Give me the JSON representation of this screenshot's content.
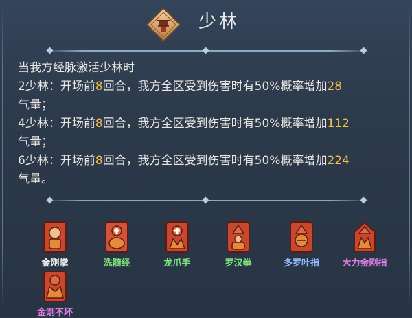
{
  "header": {
    "title": "少林",
    "emblem_icon": "temple-emblem-icon"
  },
  "description": {
    "intro": "当我方经脉激活少林时",
    "tiers": [
      {
        "label": "2少林：开场前",
        "rounds": "8",
        "middle": "回合，我方全区受到伤害时有",
        "chance": "50%",
        "tail": "概率增加",
        "amount": "28",
        "suffix": "气量；"
      },
      {
        "label": "4少林：开场前",
        "rounds": "8",
        "middle": "回合，我方全区受到伤害时有",
        "chance": "50%",
        "tail": "概率增加",
        "amount": "112",
        "suffix": "气量；"
      },
      {
        "label": "6少林：开场前",
        "rounds": "8",
        "middle": "回合，我方全区受到伤害时有",
        "chance": "50%",
        "tail": "概率增加",
        "amount": "224",
        "suffix": "气量。"
      }
    ]
  },
  "skills": [
    {
      "name": "金刚掌",
      "color": "#f2f2f2",
      "icon": "fist-strike-icon"
    },
    {
      "name": "洗髓经",
      "color": "#7ee07a",
      "icon": "meditation-cross-icon"
    },
    {
      "name": "龙爪手",
      "color": "#7ee07a",
      "icon": "dragon-claw-icon"
    },
    {
      "name": "罗汉拳",
      "color": "#7ee07a",
      "icon": "arhat-fist-icon"
    },
    {
      "name": "多罗叶指",
      "color": "#8fb8ff",
      "icon": "leaf-finger-icon"
    },
    {
      "name": "大力金刚指",
      "color": "#e07ee8",
      "icon": "vajra-finger-icon"
    },
    {
      "name": "金刚不坏",
      "color": "#e07ee8",
      "icon": "invulnerable-body-icon"
    }
  ],
  "colors": {
    "highlight": "#f0c14b",
    "text": "#e8e6e2",
    "icon_red": "#c8472f",
    "icon_orange": "#e58a3a"
  }
}
